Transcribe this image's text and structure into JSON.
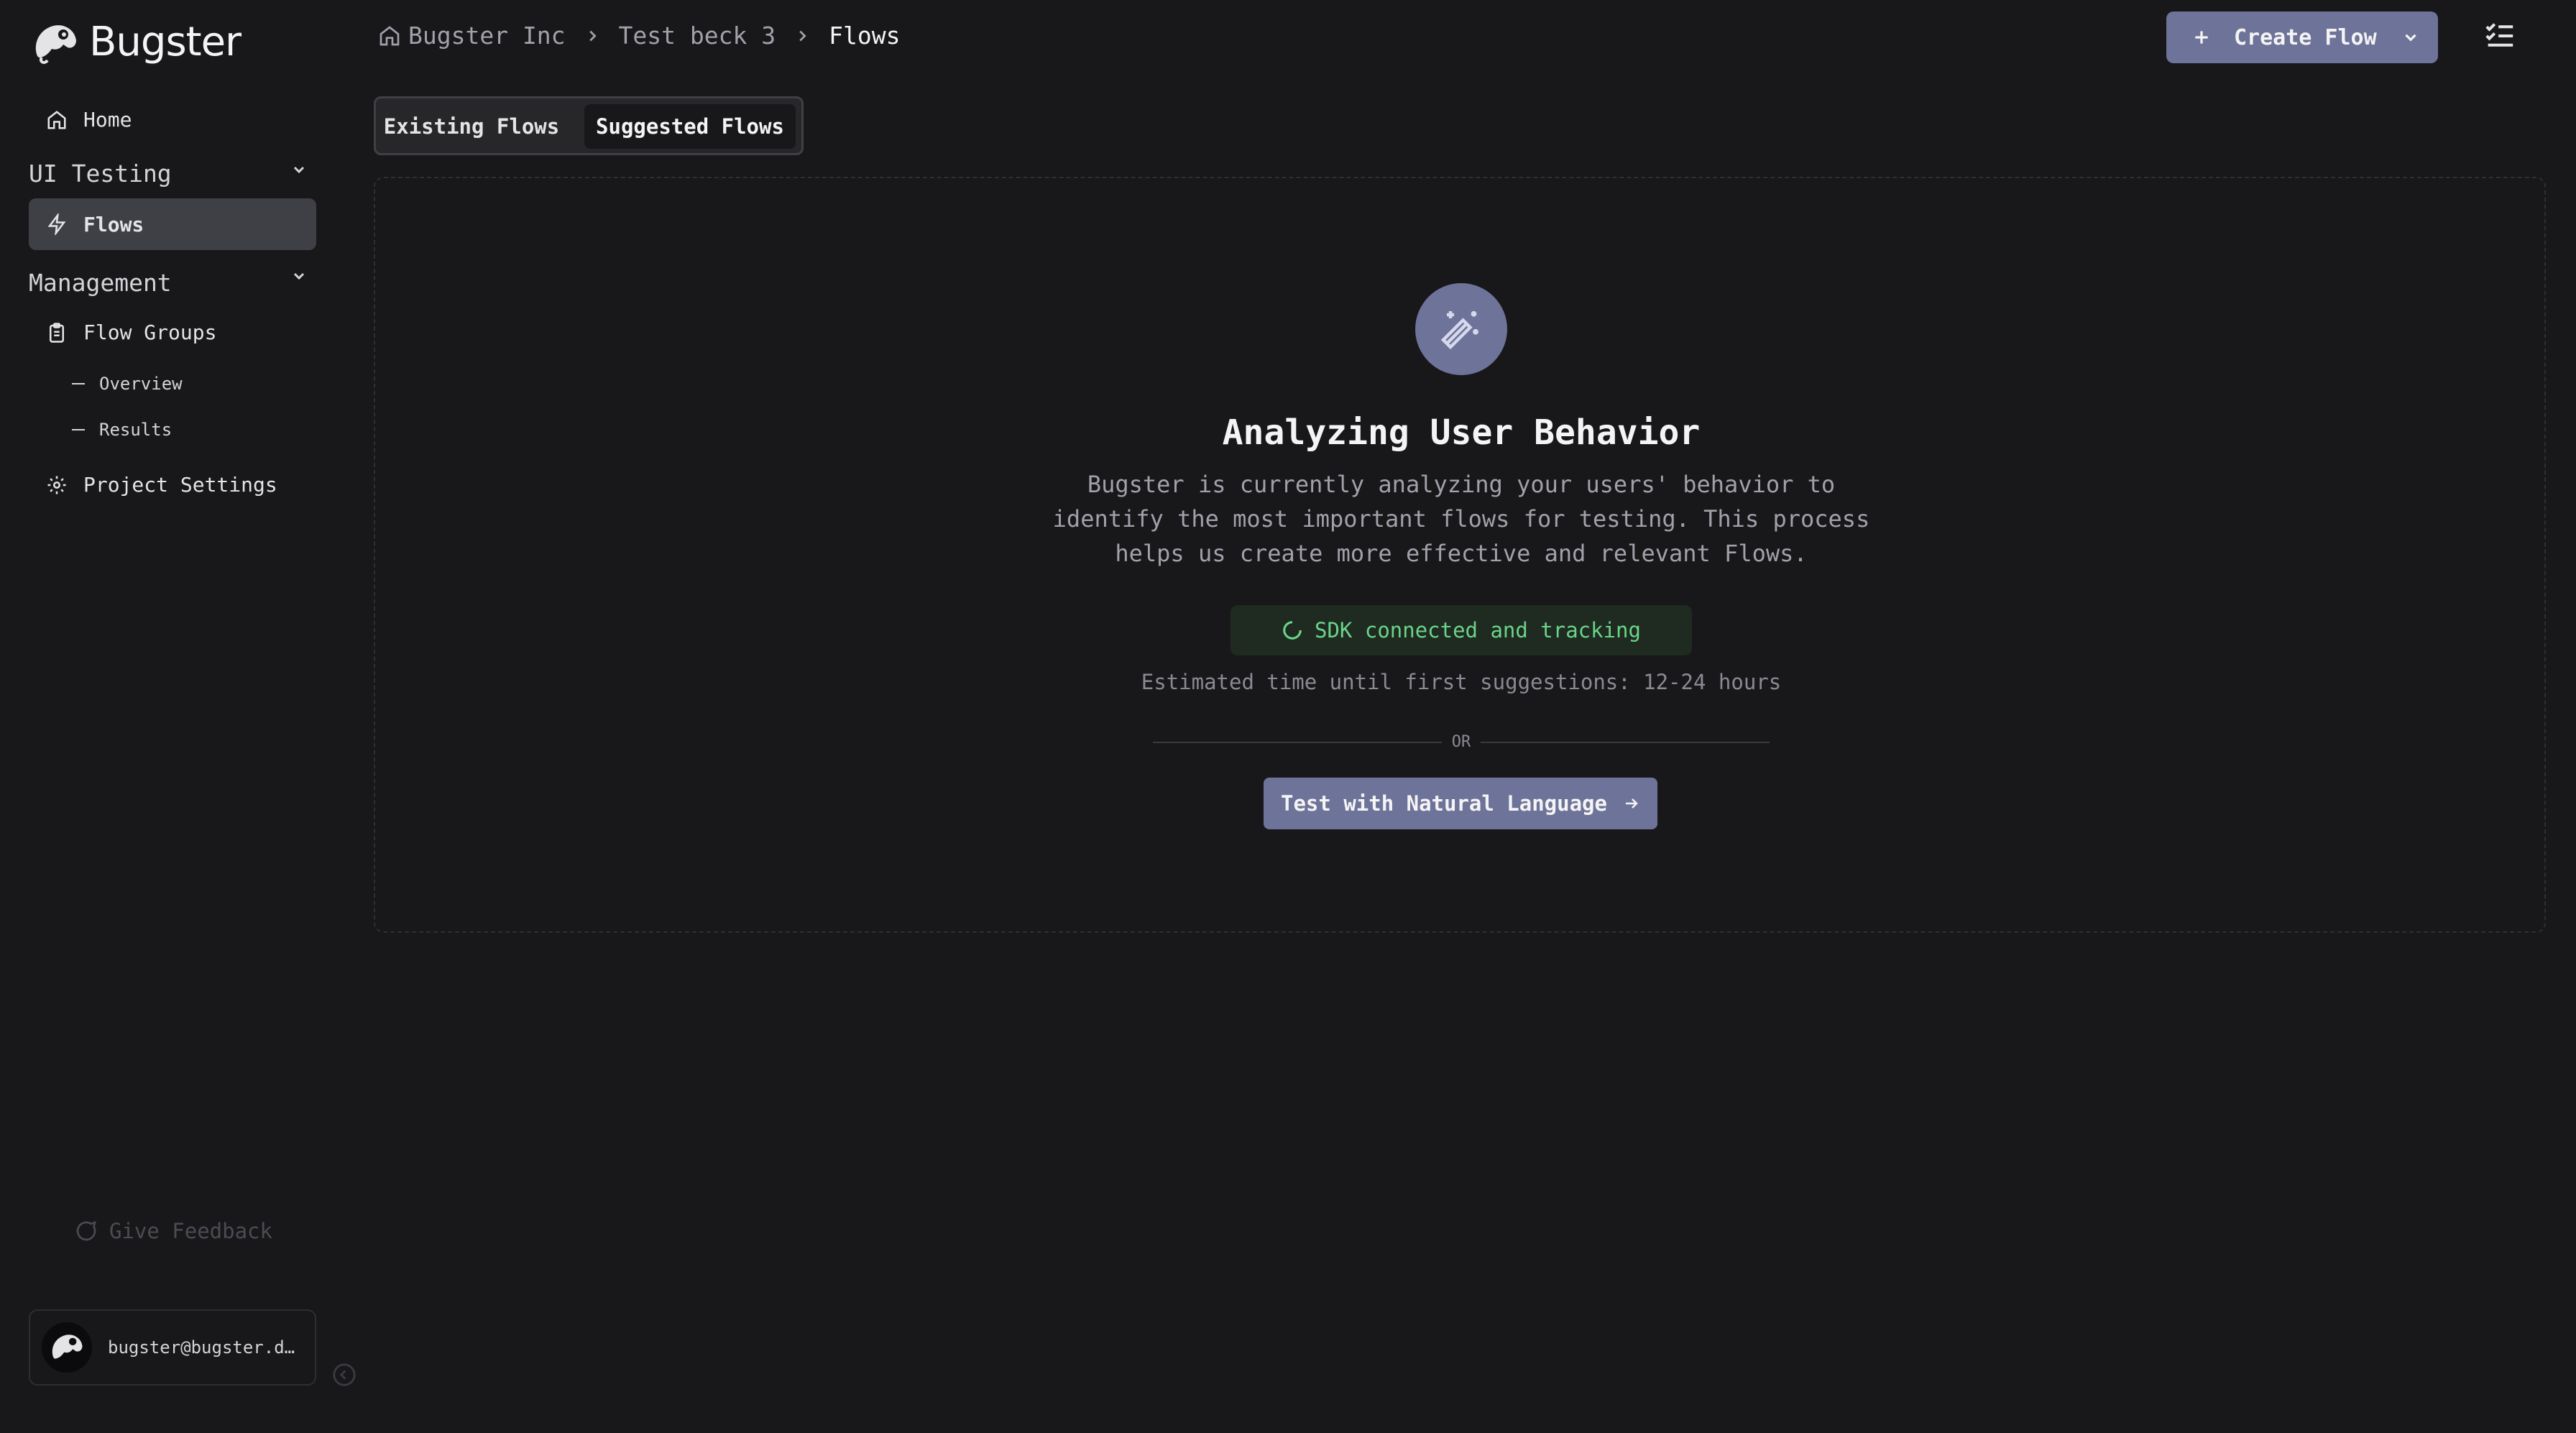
{
  "app": {
    "name": "Bugster"
  },
  "breadcrumb": {
    "org": "Bugster Inc",
    "project": "Test beck 3",
    "page": "Flows"
  },
  "header": {
    "create_label": "Create Flow"
  },
  "sidebar": {
    "home": "Home",
    "ui_testing": "UI Testing",
    "flows": "Flows",
    "management": "Management",
    "flow_groups": "Flow Groups",
    "overview": "Overview",
    "results": "Results",
    "project_settings": "Project Settings",
    "feedback": "Give Feedback",
    "user_email": "bugster@bugster.d…"
  },
  "tabs": {
    "existing": "Existing Flows",
    "suggested": "Suggested Flows"
  },
  "main": {
    "heading": "Analyzing User Behavior",
    "desc_line1": "Bugster is currently analyzing your users' behavior to",
    "desc_line2": "identify the most important flows for testing. This process",
    "desc_line3": "helps us create more effective and relevant Flows.",
    "sdk_status": "SDK connected and tracking",
    "eta": "Estimated time until first suggestions: 12-24 hours",
    "or": "OR",
    "nl_button": "Test with Natural Language"
  },
  "colors": {
    "background": "#18181b",
    "accent": "#6e7399",
    "success": "#6ad48a"
  }
}
